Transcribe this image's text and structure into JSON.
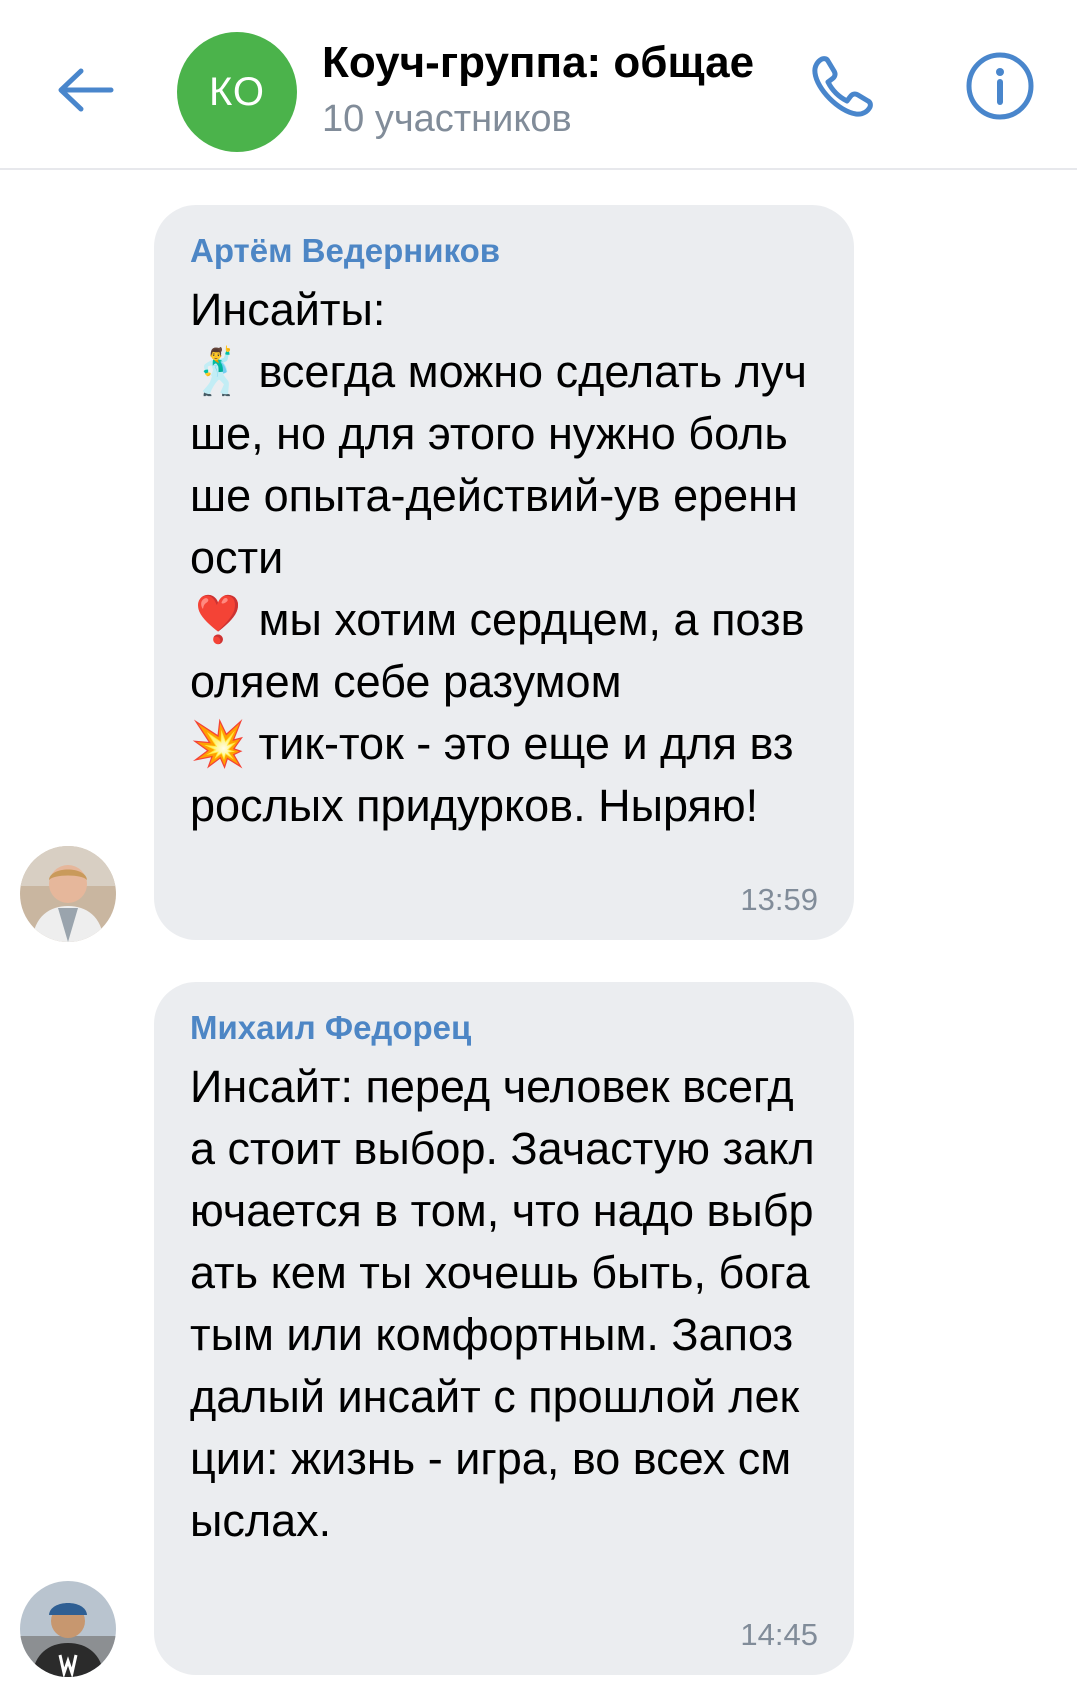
{
  "header": {
    "avatar_initials": "КО",
    "title": "Коуч-группа: общае",
    "subtitle": "10 участников",
    "accent_color": "#4986cc",
    "avatar_color": "#4bb34b"
  },
  "messages": [
    {
      "sender": "Артём Ведерников",
      "text": "Инсайты:\n🕺 всегда можно сделать лучше, но для этого нужно больше опыта-действий-ув еренности\n❣️ мы хотим сердцем, а позволяем себе разумом\n💥 тик-ток - это еще и для взрослых придурков. Ныряю!",
      "time": "13:59",
      "avatar_icon": "user-photo-icon"
    },
    {
      "sender": "Михаил Федорец",
      "text": "Инсайт: перед человек всегда стоит выбор. Зачастую заключается в том, что надо выбрать кем ты хочешь быть, богатым или комфортным. Запоздалый инсайт с прошлой лекции: жизнь - игра, во всех смыслах.",
      "time": "14:45",
      "avatar_icon": "user-photo-icon"
    }
  ]
}
